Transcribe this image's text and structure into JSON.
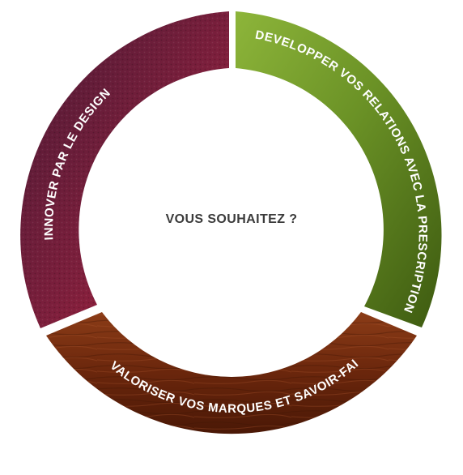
{
  "center_title": "VOUS SOUHAITEZ ?",
  "segments": [
    {
      "label": "DEVELOPPER VOS RELATIONS AVEC LA PRESCRIPTION",
      "theme": "green-leaf",
      "color": "#5f7f1c"
    },
    {
      "label": "VALORISER VOS MARQUES ET SAVOIR-FAIRE",
      "theme": "wood",
      "color": "#7a3012"
    },
    {
      "label": "INNOVER PAR LE DESIGN",
      "theme": "burgundy-fabric",
      "color": "#7a1f3a"
    }
  ]
}
